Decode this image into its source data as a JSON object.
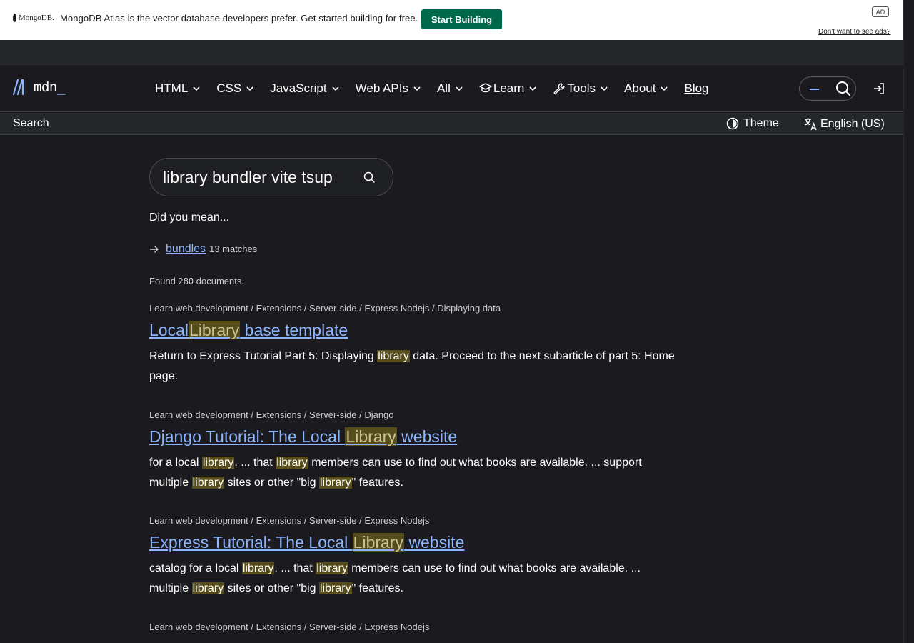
{
  "ad": {
    "logo_text": "MongoDB.",
    "message": "MongoDB Atlas is the vector database developers prefer. Get started building for free.",
    "cta": "Start Building",
    "badge": "AD",
    "optout": "Don't want to see ads?"
  },
  "header": {
    "logo_text": "mdn",
    "logo_underscore": "_",
    "nav": [
      {
        "label": "HTML"
      },
      {
        "label": "CSS"
      },
      {
        "label": "JavaScript"
      },
      {
        "label": "Web APIs"
      },
      {
        "label": "All"
      },
      {
        "label": "Learn"
      },
      {
        "label": "Tools"
      },
      {
        "label": "About"
      }
    ],
    "blog": "Blog"
  },
  "subheader": {
    "search": "Search",
    "theme": "Theme",
    "language": "English (US)"
  },
  "search": {
    "query": "library bundler vite tsup",
    "did_you_mean": "Did you mean...",
    "suggestion": "bundles",
    "suggestion_count": "13 matches",
    "found_prefix": "Found ",
    "found_count": "280",
    "found_suffix": " documents."
  },
  "results": [
    {
      "breadcrumb": "Learn web development / Extensions / Server-side / Express Nodejs / Displaying data",
      "title": [
        "Local",
        "*Library",
        " base template"
      ],
      "desc": [
        "Return to Express Tutorial Part 5: Displaying ",
        "*library",
        " data. Proceed to the next subarticle of part 5: Home page."
      ]
    },
    {
      "breadcrumb": "Learn web development / Extensions / Server-side / Django",
      "title": [
        "Django Tutorial: The Local ",
        "*Library",
        " website"
      ],
      "desc": [
        "for a local ",
        "*library",
        ". ... that ",
        "*library",
        " members can use to find out what books are available. ... support multiple ",
        "*library",
        " sites or other \"big ",
        "*library",
        "\" features."
      ]
    },
    {
      "breadcrumb": "Learn web development / Extensions / Server-side / Express Nodejs",
      "title": [
        "Express Tutorial: The Local ",
        "*Library",
        " website"
      ],
      "desc": [
        "catalog for a local ",
        "*library",
        ". ... that ",
        "*library",
        " members can use to find out what books are available. ... multiple ",
        "*library",
        " sites or other \"big ",
        "*library",
        "\" features."
      ]
    },
    {
      "breadcrumb": "Learn web development / Extensions / Server-side / Express Nodejs",
      "title": [],
      "desc": []
    }
  ],
  "colors": {
    "background": "#1b1b1f",
    "link": "#8cb4ff",
    "highlight": "#574d1a",
    "ad_cta": "#00684a"
  }
}
